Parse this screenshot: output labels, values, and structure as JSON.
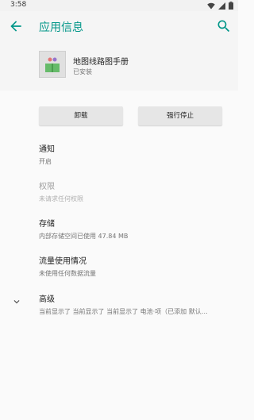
{
  "status_bar": {
    "time": "3:58",
    "icons": [
      "wifi-icon",
      "signal-icon",
      "battery-icon"
    ]
  },
  "app_bar": {
    "title": "应用信息",
    "back_icon": "arrow-back-icon",
    "search_icon": "search-icon"
  },
  "app": {
    "name": "地图线路图手册",
    "status": "已安装"
  },
  "buttons": {
    "uninstall": "卸载",
    "force_stop": "强行停止"
  },
  "prefs": [
    {
      "title": "通知",
      "summary": "开启",
      "enabled": true
    },
    {
      "title": "权限",
      "summary": "未请求任何权限",
      "enabled": false
    },
    {
      "title": "存储",
      "summary": "内部存储空间已使用 47.84 MB",
      "enabled": true
    },
    {
      "title": "流量使用情况",
      "summary": "未使用任何数据流量",
      "enabled": true
    },
    {
      "title": "高级",
      "summary": "当前显示了 当前显示了 当前显示了 电池·项（已添加 默认…",
      "enabled": true
    }
  ],
  "colors": {
    "accent": "#009688"
  }
}
